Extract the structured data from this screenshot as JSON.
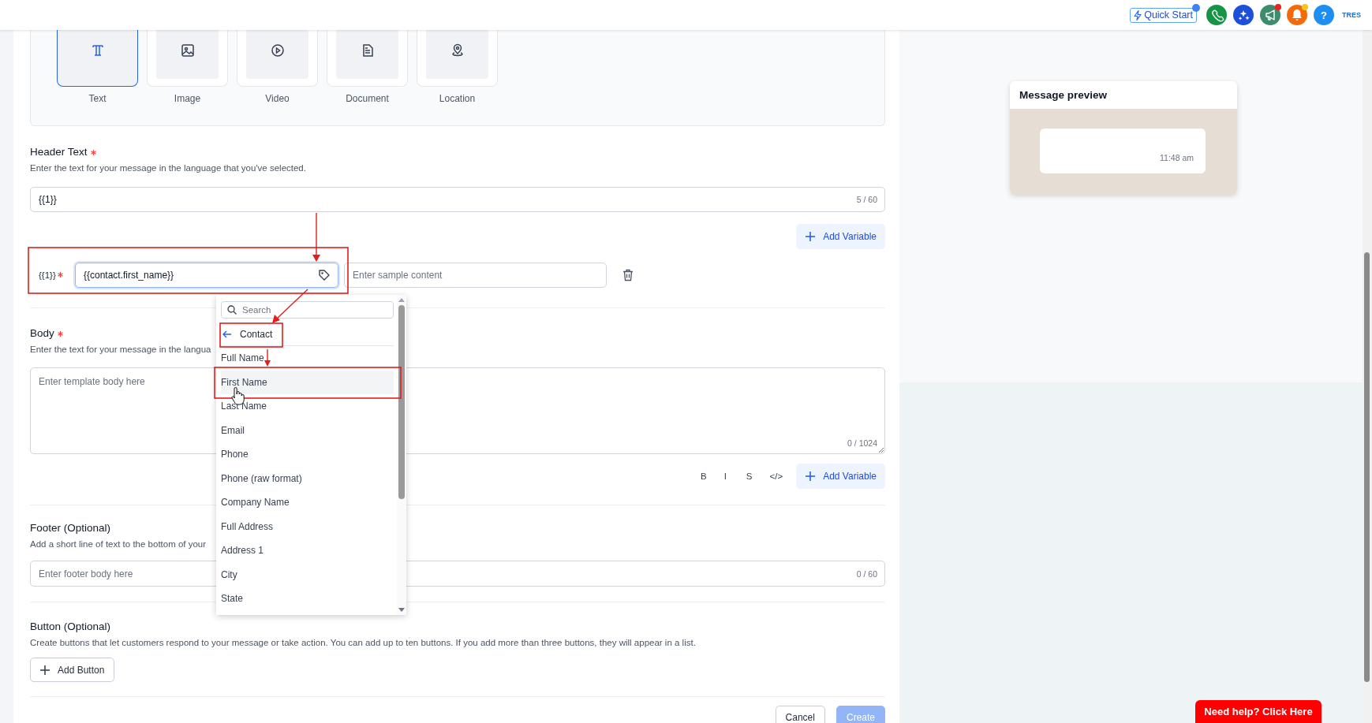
{
  "top_bar": {
    "quick_start": "Quick Start",
    "help": "?",
    "user": "TRES"
  },
  "media_types": [
    {
      "label": "Text",
      "kind": "text",
      "selected": true
    },
    {
      "label": "Image",
      "kind": "image",
      "selected": false
    },
    {
      "label": "Video",
      "kind": "video",
      "selected": false
    },
    {
      "label": "Document",
      "kind": "document",
      "selected": false
    },
    {
      "label": "Location",
      "kind": "location",
      "selected": false
    }
  ],
  "header_text": {
    "label": "Header Text",
    "required": true,
    "hint": "Enter the text for your message in the language that you've selected.",
    "value": "{{1}}",
    "counter": "5 / 60",
    "add_variable": "Add Variable"
  },
  "variables": [
    {
      "label": "{{1}}",
      "required": true,
      "value": "{{contact.first_name}}",
      "sample_placeholder": "Enter sample content"
    }
  ],
  "variable_menu": {
    "search_placeholder": "Search",
    "group": "Contact",
    "items": [
      {
        "label": "Full Name",
        "selected": false
      },
      {
        "label": "First Name",
        "selected": true
      },
      {
        "label": "Last Name",
        "selected": false
      },
      {
        "label": "Email",
        "selected": false
      },
      {
        "label": "Phone",
        "selected": false
      },
      {
        "label": "Phone (raw format)",
        "selected": false
      },
      {
        "label": "Company Name",
        "selected": false
      },
      {
        "label": "Full Address",
        "selected": false
      },
      {
        "label": "Address 1",
        "selected": false
      },
      {
        "label": "City",
        "selected": false
      },
      {
        "label": "State",
        "selected": false
      }
    ]
  },
  "body": {
    "label": "Body",
    "required": true,
    "hint": "Enter the text for your message in the langua",
    "placeholder": "Enter template body here",
    "counter": "0 / 1024",
    "format_buttons": [
      "B",
      "I",
      "S",
      "</>"
    ],
    "add_variable": "Add Variable"
  },
  "footer": {
    "label": "Footer (Optional)",
    "required": false,
    "hint": "Add a short line of text to the bottom of your",
    "placeholder": "Enter footer body here",
    "counter": "0 / 60"
  },
  "buttons_section": {
    "label": "Button (Optional)",
    "required": false,
    "hint": "Create buttons that let customers respond to your message or take action. You can add up to ten buttons. If you add more than three buttons, they will appear in a list.",
    "add_button": "Add Button"
  },
  "actions": [
    {
      "label": "Cancel",
      "kind": "secondary",
      "disabled": false
    },
    {
      "label": "Create",
      "kind": "primary",
      "disabled": true
    }
  ],
  "preview": {
    "title": "Message preview",
    "time": "11:48 am"
  },
  "help_button": "Need help? Click Here"
}
